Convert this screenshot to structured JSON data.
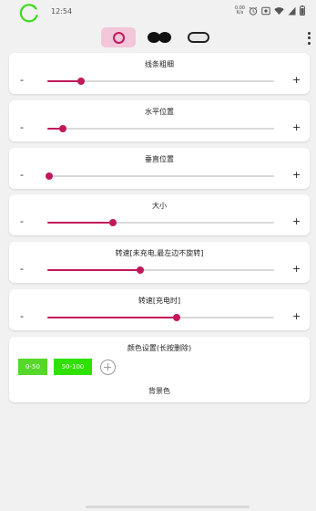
{
  "status_bar": {
    "time": "12:54",
    "net_speed_value": "0.00",
    "net_speed_unit": "K/s",
    "icons": [
      "alarm-icon",
      "screen-record-icon",
      "wifi-icon",
      "signal-icon",
      "battery-icon"
    ]
  },
  "mode_tabs": [
    "ring-mode-icon",
    "goggles-mode-icon",
    "pill-mode-icon"
  ],
  "accent_color": "#c2185b",
  "sliders": [
    {
      "label": "线条粗细",
      "minus": "-",
      "plus": "+",
      "value": 0.15
    },
    {
      "label": "水平位置",
      "minus": "-",
      "plus": "+",
      "value": 0.07
    },
    {
      "label": "垂直位置",
      "minus": "-",
      "plus": "+",
      "value": 0.01
    },
    {
      "label": "大小",
      "minus": "-",
      "plus": "+",
      "value": 0.29
    },
    {
      "label": "转速[未充电,最左边不旋转]",
      "minus": "-",
      "plus": "+",
      "value": 0.41
    },
    {
      "label": "转速[充电时]",
      "minus": "-",
      "plus": "+",
      "value": 0.57
    }
  ],
  "color_settings": {
    "title": "颜色设置(长按删除)",
    "swatches": [
      {
        "label": "0-50",
        "color": "#55d829"
      },
      {
        "label": "50-100",
        "color": "#2ee100"
      }
    ],
    "background_label": "背景色"
  }
}
